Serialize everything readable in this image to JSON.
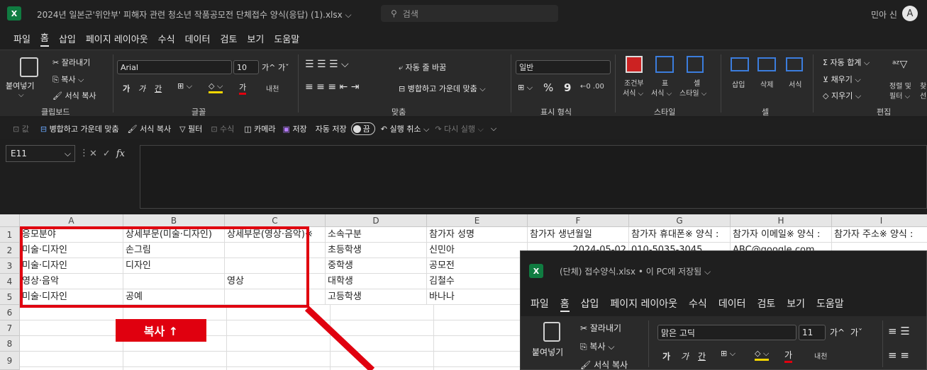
{
  "titlebar": {
    "app_icon": "X",
    "doc_title": "2024년 일본군'위안부' 피해자 관련 청소년 작품공모전 단체접수 양식(응답) (1).xlsx ⌵",
    "search_placeholder": "검색",
    "user_name": "민아 신",
    "avatar_letter": "A"
  },
  "menu": [
    "파일",
    "홈",
    "삽입",
    "페이지 레이아웃",
    "수식",
    "데이터",
    "검토",
    "보기",
    "도움말"
  ],
  "ribbon": {
    "clipboard": {
      "paste": "붙여넣기",
      "cut": "잘라내기",
      "copy": "복사 ⌵",
      "format_painter": "서식 복사",
      "label": "클립보드"
    },
    "font": {
      "name": "Arial",
      "size": "10",
      "label": "글꼴",
      "grow": "가^",
      "shrink": "가ˇ",
      "bold": "가",
      "italic": "가",
      "underline": "간",
      "strike": "가",
      "phonetic": "내천"
    },
    "align": {
      "wrap": "자동 줄 바꿈",
      "merge": "병합하고 가운데 맞춤 ⌵",
      "label": "맞춤"
    },
    "number": {
      "format": "일반",
      "percent": "%",
      "comma": "9",
      "label": "표시 형식"
    },
    "styles": {
      "cond": "조건부",
      "cond2": "서식 ⌵",
      "table": "표",
      "table2": "서식 ⌵",
      "cell": "셀",
      "cell2": "스타일 ⌵",
      "label": "스타일"
    },
    "cells": {
      "insert": "삽입",
      "delete": "삭제",
      "format": "서식",
      "label": "셀"
    },
    "edit": {
      "autosum": "자동 합계 ⌵",
      "fill": "채우기 ⌵",
      "clear": "지우기 ⌵",
      "sort": "정렬 및",
      "sort2": "필터 ⌵",
      "find": "찾",
      "find2": "선",
      "label": "편집"
    }
  },
  "qat": {
    "value": "값",
    "merge": "병합하고 가운데 맞춤",
    "painter": "서식 복사",
    "filter": "필터",
    "formula": "수식",
    "camera": "카메라",
    "save": "저장",
    "autosave": "자동 저장",
    "toggle": "끔",
    "undo": "실행 취소",
    "redo": "다시 실행"
  },
  "formula_bar": {
    "name_box": "E11",
    "fx": "fx",
    "content": ""
  },
  "columns": [
    "A",
    "B",
    "C",
    "D",
    "E",
    "F",
    "G",
    "H",
    "I"
  ],
  "rows": [
    "1",
    "2",
    "3",
    "4",
    "5",
    "6",
    "7",
    "8",
    "9"
  ],
  "cells": {
    "r1": [
      "응모분야",
      "상세부문(미술·디자인)",
      "상세부문(영상·음악)※",
      "소속구분",
      "참가자 성명",
      "참가자 생년월일",
      "참가자 휴대폰※ 양식 :",
      "참가자 이메일※ 양식 :",
      "참가자 주소※ 양식 :"
    ],
    "r2": [
      "미술·디자인",
      "손그림",
      "",
      "초등학생",
      "신민아",
      "2024-05-02",
      "010-5035-3045",
      "ABC@google.com",
      ""
    ],
    "r3": [
      "미술·디자인",
      "디자인",
      "",
      "중학생",
      "공모전",
      "",
      "",
      "",
      ""
    ],
    "r4": [
      "영상·음악",
      "",
      "영상",
      "대학생",
      "김철수",
      "",
      "",
      "",
      ""
    ],
    "r5": [
      "미술·디자인",
      "공예",
      "",
      "고등학생",
      "바나나",
      "",
      "",
      "",
      ""
    ]
  },
  "annotation": {
    "copy_label": "복사 ↑"
  },
  "overlay": {
    "title": "(단체) 접수양식.xlsx • 이 PC에 저장됨 ⌵",
    "menu": [
      "파일",
      "홈",
      "삽입",
      "페이지 레이아웃",
      "수식",
      "데이터",
      "검토",
      "보기",
      "도움말"
    ],
    "paste": "붙여넣기",
    "cut": "잘라내기",
    "copy": "복사 ⌵",
    "format_painter": "서식 복사",
    "font_name": "맑은 고딕",
    "font_size": "11"
  },
  "colors": {
    "excel_green": "#107c41",
    "annotation_red": "#e0000f"
  }
}
